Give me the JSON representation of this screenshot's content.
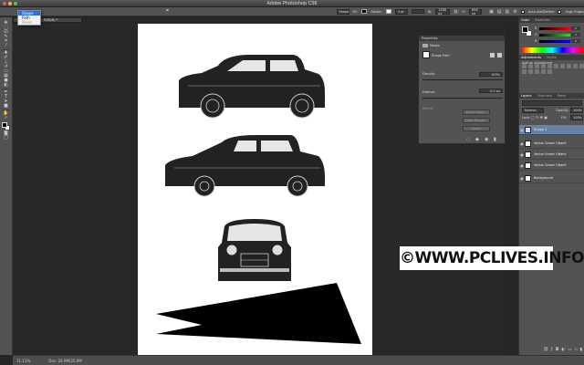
{
  "window": {
    "title": "Adobe Photoshop CS6"
  },
  "options_bar": {
    "mode_selected": "Shape",
    "fill_label": "Fill:",
    "stroke_label": "Stroke:",
    "stroke_width": "3 pt",
    "width_label": "W:",
    "width_value": "1468 px",
    "height_label": "H:",
    "height_value": "656 px",
    "align_edges": "Align Edges",
    "auto_add_delete": "Auto Add/Delete"
  },
  "mode_menu": {
    "items": [
      "Shape",
      "Path",
      "Pixels"
    ],
    "selected_index": 0
  },
  "document_tab": {
    "label": "11.1% (Shape 1, RGB/8) *"
  },
  "status": {
    "zoom": "11.11%",
    "doc": "Doc: 24.9M/25.0M"
  },
  "properties_panel": {
    "title": "Properties",
    "section": "Masks",
    "mask_type": "Shape Path",
    "density_label": "Density:",
    "density_value": "100%",
    "feather_label": "Feather:",
    "feather_value": "0.0 px",
    "refine_label": "Refine:",
    "btn_mask_edge": "Mask Edge...",
    "btn_color_range": "Color Range...",
    "btn_invert": "Invert"
  },
  "color_panel": {
    "tabs": [
      "Color",
      "Swatches"
    ],
    "rows": [
      {
        "label": "R",
        "value": "0"
      },
      {
        "label": "G",
        "value": "0"
      },
      {
        "label": "B",
        "value": "0"
      }
    ]
  },
  "adjustments_panel": {
    "tabs": [
      "Adjustments",
      "Styles"
    ],
    "subtitle": "Add an adjustment"
  },
  "layers_panel": {
    "tabs": [
      "Layers",
      "Channels",
      "Paths"
    ],
    "blend_mode": "Normal",
    "opacity_label": "Opacity:",
    "opacity_value": "100%",
    "lock_label": "Lock:",
    "fill_label": "Fill:",
    "fill_value": "100%",
    "layers": [
      {
        "name": "Shape 1",
        "selected": true
      },
      {
        "name": "Vector Smart Object",
        "selected": false
      },
      {
        "name": "Vector Smart Object",
        "selected": false
      },
      {
        "name": "Vector Smart Object",
        "selected": false
      },
      {
        "name": "Background",
        "selected": false
      }
    ]
  },
  "watermark": {
    "text": "©WWW.PCLIVES.INFO"
  },
  "colors": {
    "accent": "#2f6fd6",
    "selected_layer": "#6483a6",
    "panel": "#535353",
    "canvas_bg": "#282828"
  }
}
